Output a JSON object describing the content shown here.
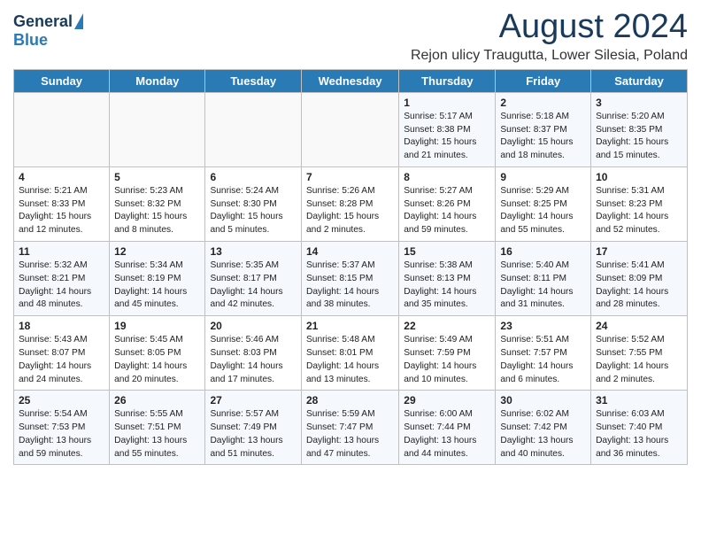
{
  "header": {
    "logo_general": "General",
    "logo_blue": "Blue",
    "main_title": "August 2024",
    "subtitle": "Rejon ulicy Traugutta, Lower Silesia, Poland"
  },
  "days_of_week": [
    "Sunday",
    "Monday",
    "Tuesday",
    "Wednesday",
    "Thursday",
    "Friday",
    "Saturday"
  ],
  "weeks": [
    [
      {
        "day": "",
        "info": ""
      },
      {
        "day": "",
        "info": ""
      },
      {
        "day": "",
        "info": ""
      },
      {
        "day": "",
        "info": ""
      },
      {
        "day": "1",
        "info": "Sunrise: 5:17 AM\nSunset: 8:38 PM\nDaylight: 15 hours\nand 21 minutes."
      },
      {
        "day": "2",
        "info": "Sunrise: 5:18 AM\nSunset: 8:37 PM\nDaylight: 15 hours\nand 18 minutes."
      },
      {
        "day": "3",
        "info": "Sunrise: 5:20 AM\nSunset: 8:35 PM\nDaylight: 15 hours\nand 15 minutes."
      }
    ],
    [
      {
        "day": "4",
        "info": "Sunrise: 5:21 AM\nSunset: 8:33 PM\nDaylight: 15 hours\nand 12 minutes."
      },
      {
        "day": "5",
        "info": "Sunrise: 5:23 AM\nSunset: 8:32 PM\nDaylight: 15 hours\nand 8 minutes."
      },
      {
        "day": "6",
        "info": "Sunrise: 5:24 AM\nSunset: 8:30 PM\nDaylight: 15 hours\nand 5 minutes."
      },
      {
        "day": "7",
        "info": "Sunrise: 5:26 AM\nSunset: 8:28 PM\nDaylight: 15 hours\nand 2 minutes."
      },
      {
        "day": "8",
        "info": "Sunrise: 5:27 AM\nSunset: 8:26 PM\nDaylight: 14 hours\nand 59 minutes."
      },
      {
        "day": "9",
        "info": "Sunrise: 5:29 AM\nSunset: 8:25 PM\nDaylight: 14 hours\nand 55 minutes."
      },
      {
        "day": "10",
        "info": "Sunrise: 5:31 AM\nSunset: 8:23 PM\nDaylight: 14 hours\nand 52 minutes."
      }
    ],
    [
      {
        "day": "11",
        "info": "Sunrise: 5:32 AM\nSunset: 8:21 PM\nDaylight: 14 hours\nand 48 minutes."
      },
      {
        "day": "12",
        "info": "Sunrise: 5:34 AM\nSunset: 8:19 PM\nDaylight: 14 hours\nand 45 minutes."
      },
      {
        "day": "13",
        "info": "Sunrise: 5:35 AM\nSunset: 8:17 PM\nDaylight: 14 hours\nand 42 minutes."
      },
      {
        "day": "14",
        "info": "Sunrise: 5:37 AM\nSunset: 8:15 PM\nDaylight: 14 hours\nand 38 minutes."
      },
      {
        "day": "15",
        "info": "Sunrise: 5:38 AM\nSunset: 8:13 PM\nDaylight: 14 hours\nand 35 minutes."
      },
      {
        "day": "16",
        "info": "Sunrise: 5:40 AM\nSunset: 8:11 PM\nDaylight: 14 hours\nand 31 minutes."
      },
      {
        "day": "17",
        "info": "Sunrise: 5:41 AM\nSunset: 8:09 PM\nDaylight: 14 hours\nand 28 minutes."
      }
    ],
    [
      {
        "day": "18",
        "info": "Sunrise: 5:43 AM\nSunset: 8:07 PM\nDaylight: 14 hours\nand 24 minutes."
      },
      {
        "day": "19",
        "info": "Sunrise: 5:45 AM\nSunset: 8:05 PM\nDaylight: 14 hours\nand 20 minutes."
      },
      {
        "day": "20",
        "info": "Sunrise: 5:46 AM\nSunset: 8:03 PM\nDaylight: 14 hours\nand 17 minutes."
      },
      {
        "day": "21",
        "info": "Sunrise: 5:48 AM\nSunset: 8:01 PM\nDaylight: 14 hours\nand 13 minutes."
      },
      {
        "day": "22",
        "info": "Sunrise: 5:49 AM\nSunset: 7:59 PM\nDaylight: 14 hours\nand 10 minutes."
      },
      {
        "day": "23",
        "info": "Sunrise: 5:51 AM\nSunset: 7:57 PM\nDaylight: 14 hours\nand 6 minutes."
      },
      {
        "day": "24",
        "info": "Sunrise: 5:52 AM\nSunset: 7:55 PM\nDaylight: 14 hours\nand 2 minutes."
      }
    ],
    [
      {
        "day": "25",
        "info": "Sunrise: 5:54 AM\nSunset: 7:53 PM\nDaylight: 13 hours\nand 59 minutes."
      },
      {
        "day": "26",
        "info": "Sunrise: 5:55 AM\nSunset: 7:51 PM\nDaylight: 13 hours\nand 55 minutes."
      },
      {
        "day": "27",
        "info": "Sunrise: 5:57 AM\nSunset: 7:49 PM\nDaylight: 13 hours\nand 51 minutes."
      },
      {
        "day": "28",
        "info": "Sunrise: 5:59 AM\nSunset: 7:47 PM\nDaylight: 13 hours\nand 47 minutes."
      },
      {
        "day": "29",
        "info": "Sunrise: 6:00 AM\nSunset: 7:44 PM\nDaylight: 13 hours\nand 44 minutes."
      },
      {
        "day": "30",
        "info": "Sunrise: 6:02 AM\nSunset: 7:42 PM\nDaylight: 13 hours\nand 40 minutes."
      },
      {
        "day": "31",
        "info": "Sunrise: 6:03 AM\nSunset: 7:40 PM\nDaylight: 13 hours\nand 36 minutes."
      }
    ]
  ]
}
